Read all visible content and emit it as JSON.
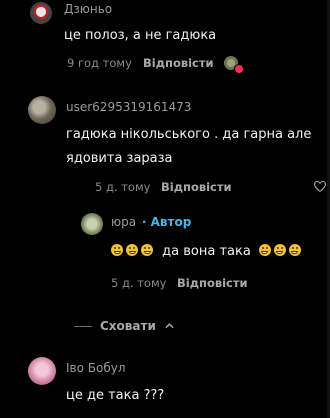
{
  "comments": [
    {
      "author": "Дзюньо",
      "text": "це полоз, а не гадюка",
      "time": "9 год тому",
      "reply_label": "Відповісти"
    },
    {
      "author": "user6295319161473",
      "text_line1": "гадюка нікольського . да гарна але",
      "text_line2": "ядовита зараза",
      "time": "5 д. тому",
      "reply_label": "Відповісти"
    }
  ],
  "reply": {
    "author": "юра",
    "author_tag": "· Автор",
    "text": "да вона така",
    "time": "5 д. тому",
    "reply_label": "Відповісти"
  },
  "hide_label": "Сховати",
  "last_comment": {
    "author": "Іво Бобул",
    "text": "це де така ???"
  },
  "colors": {
    "author_tag": "#4fb3e8",
    "reaction_badge": "#ff2d55"
  },
  "icons": [
    "heart-outline-icon",
    "chevron-up-icon",
    "grin-emoji-icon",
    "reaction-avatar-icon"
  ]
}
